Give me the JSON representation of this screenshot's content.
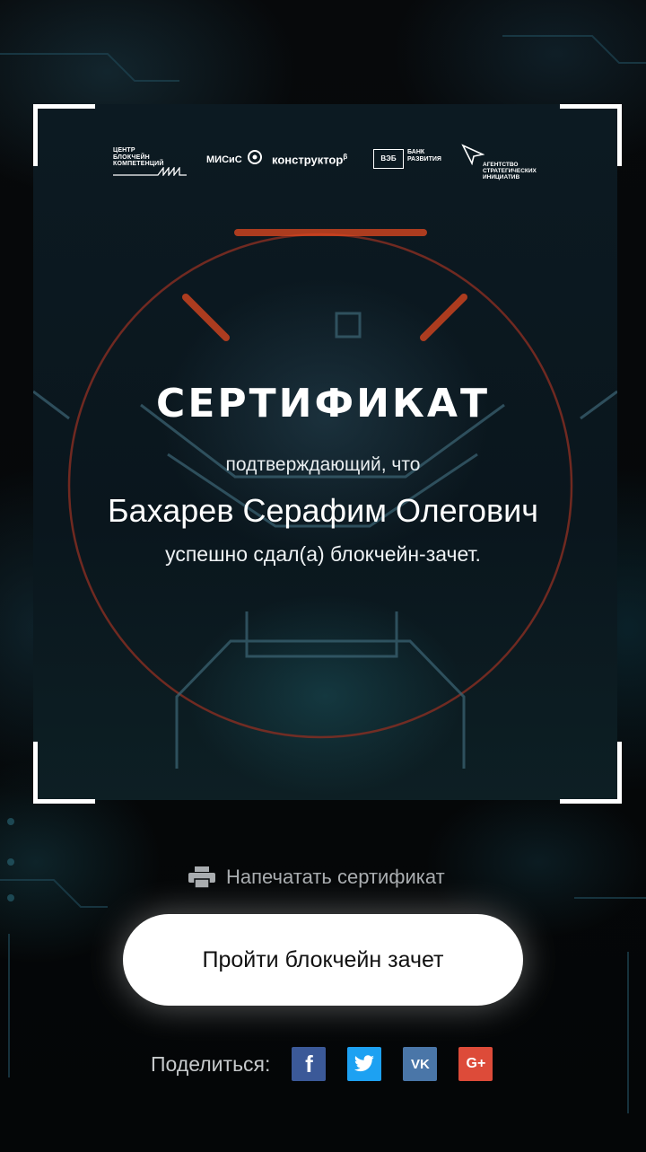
{
  "certificate": {
    "title": "СЕРТИФИКАТ",
    "line1": "подтверждающий, что",
    "name": "Бахарев Серафим Олегович",
    "line3": "успешно сдал(а) блокчейн-зачет."
  },
  "logos": {
    "cbk": [
      "ЦЕНТР",
      "БЛОКЧЕЙН",
      "КОМПЕТЕНЦИЙ"
    ],
    "misis": "МИСиС",
    "konstruktor": "конструктор",
    "konstruktor_sup": "β",
    "veb_box": "ВЭБ",
    "veb_text": [
      "БАНК",
      "РАЗВИТИЯ"
    ],
    "asi": [
      "АГЕНТСТВО",
      "СТРАТЕГИЧЕСКИХ",
      "ИНИЦИАТИВ"
    ]
  },
  "actions": {
    "print_label": "Напечатать сертификат",
    "primary_button": "Пройти блокчейн зачет"
  },
  "share": {
    "label": "Поделиться:",
    "networks": [
      {
        "name": "facebook",
        "glyph": "f",
        "color": "#3b5998"
      },
      {
        "name": "twitter",
        "glyph": "",
        "color": "#1da1f2"
      },
      {
        "name": "vk",
        "glyph": "VK",
        "color": "#4a76a8"
      },
      {
        "name": "google-plus",
        "glyph": "G+",
        "color": "#dd4b39"
      }
    ]
  }
}
